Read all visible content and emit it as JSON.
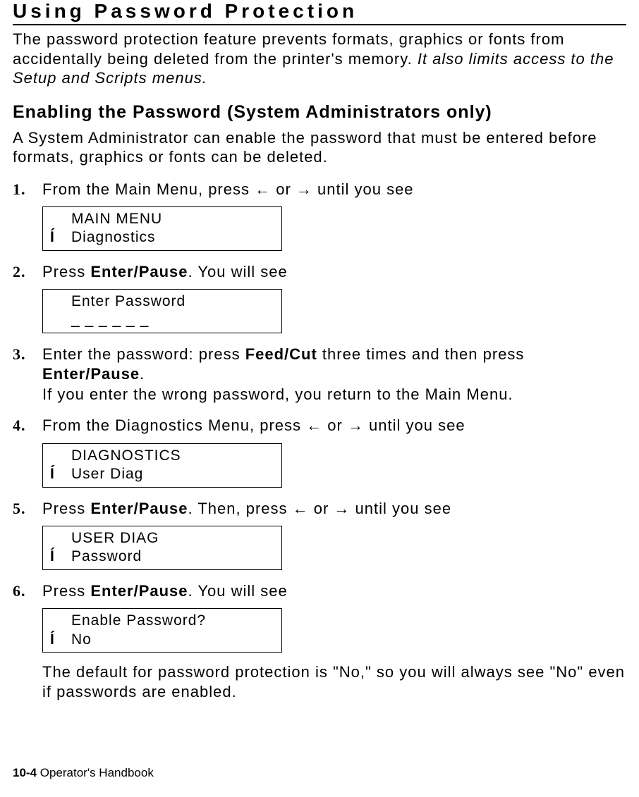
{
  "title": "Using Password Protection",
  "intro_plain": "The password protection feature prevents formats, graphics or fonts from accidentally being deleted from the printer's memory.  ",
  "intro_italic": "It also limits access to the Setup and Scripts menus.",
  "h2": "Enabling the Password (System Administrators only)",
  "para1": "A System Administrator can enable the password that must be entered before formats, graphics or fonts can be deleted.",
  "arrows": {
    "left": "←",
    "right": "→",
    "lcd_left": "Í"
  },
  "steps": {
    "s1": {
      "pre": "From the Main Menu, press ",
      "mid": " or ",
      "post": " until you see",
      "lcd": {
        "line1": "MAIN MENU",
        "line2": "Diagnostics",
        "arrow_on_line2": true
      }
    },
    "s2": {
      "pre": "Press ",
      "bold1": "Enter/Pause",
      "post": ".  You will see",
      "lcd": {
        "line1": "Enter Password",
        "line2": "_ _ _ _ _ _",
        "arrow_on_line2": false
      }
    },
    "s3": {
      "pre": "Enter the password:  press ",
      "bold1": "Feed/Cut",
      "mid1": " three times and then press ",
      "bold2": "Enter/Pause",
      "post1": ".",
      "line2": "If you enter the wrong password, you return to the Main Menu."
    },
    "s4": {
      "pre": "From the Diagnostics Menu, press ",
      "mid": " or ",
      "post": " until you see",
      "lcd": {
        "line1": "DIAGNOSTICS",
        "line2": "User Diag",
        "arrow_on_line2": true
      }
    },
    "s5": {
      "pre": "Press ",
      "bold1": "Enter/Pause",
      "mid1": ".  Then, press ",
      "mid2": " or ",
      "post": " until you see",
      "lcd": {
        "line1": "USER DIAG",
        "line2": "Password",
        "arrow_on_line2": true
      }
    },
    "s6": {
      "pre": "Press ",
      "bold1": "Enter/Pause",
      "post": ".  You will see",
      "lcd": {
        "line1": "Enable Password?",
        "line2": "No",
        "arrow_on_line2": true
      },
      "note": "The default for password protection is \"No,\" so you will always see \"No\" even if passwords are enabled."
    }
  },
  "footer": {
    "page": "10-4",
    "label": "  Operator's Handbook"
  }
}
